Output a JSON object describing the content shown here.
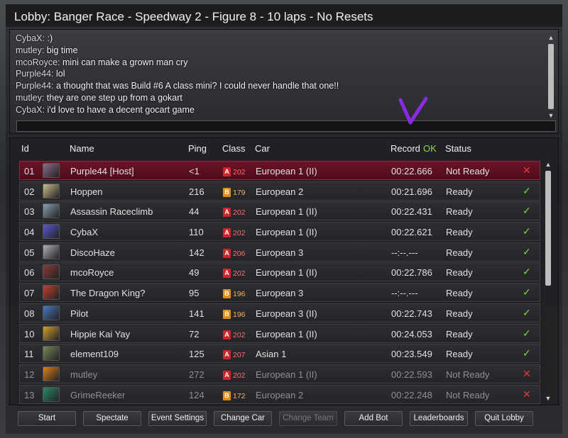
{
  "window": {
    "title": "Lobby: Banger Race - Speedway 2 - Figure 8 - 10 laps - No Resets"
  },
  "chat": {
    "lines": [
      {
        "user": "CybaX:",
        "text": " :)"
      },
      {
        "user": "mutley:",
        "text": " big time"
      },
      {
        "user": "mcoRoyce:",
        "text": " mini can make a grown man cry"
      },
      {
        "user": "Purple44:",
        "text": " lol"
      },
      {
        "user": "Purple44:",
        "text": " a thought that was Build #6 A class mini? I could never handle that one!!"
      },
      {
        "user": "mutley:",
        "text": " they are one step up from a gokart"
      },
      {
        "user": "CybaX:",
        "text": " i'd love to have a decent gocart game"
      }
    ],
    "input_value": ""
  },
  "table": {
    "headers": {
      "id": "Id",
      "name": "Name",
      "ping": "Ping",
      "class": "Class",
      "car": "Car",
      "record": "Record",
      "record_ok": "OK",
      "status": "Status"
    },
    "rows": [
      {
        "id": "01",
        "name": "Purple44 [Host]",
        "ping": "<1",
        "class_letter": "A",
        "class_num": "202",
        "car": "European 1 (II)",
        "record": "00:22.666",
        "status": "Not Ready",
        "ok": false,
        "host": true,
        "dim": false,
        "avatar_color": "#8a6e8a"
      },
      {
        "id": "02",
        "name": "Hoppen",
        "ping": "216",
        "class_letter": "B",
        "class_num": "179",
        "car": "European 2",
        "record": "00:21.696",
        "status": "Ready",
        "ok": true,
        "host": false,
        "dim": false,
        "avatar_color": "#c9c08a"
      },
      {
        "id": "03",
        "name": "Assassin Raceclimb",
        "ping": "44",
        "class_letter": "A",
        "class_num": "202",
        "car": "European 1 (II)",
        "record": "00:22.431",
        "status": "Ready",
        "ok": true,
        "host": false,
        "dim": false,
        "avatar_color": "#8aa0b0"
      },
      {
        "id": "04",
        "name": "CybaX",
        "ping": "110",
        "class_letter": "A",
        "class_num": "202",
        "car": "European 1 (II)",
        "record": "00:22.621",
        "status": "Ready",
        "ok": true,
        "host": false,
        "dim": false,
        "avatar_color": "#5a5ad0"
      },
      {
        "id": "05",
        "name": "DiscoHaze",
        "ping": "142",
        "class_letter": "A",
        "class_num": "206",
        "car": "European 3",
        "record": "--:--.---",
        "status": "Ready",
        "ok": true,
        "host": false,
        "dim": false,
        "avatar_color": "#b0b0b8"
      },
      {
        "id": "06",
        "name": "mcoRoyce",
        "ping": "49",
        "class_letter": "A",
        "class_num": "202",
        "car": "European 1 (II)",
        "record": "00:22.786",
        "status": "Ready",
        "ok": true,
        "host": false,
        "dim": false,
        "avatar_color": "#8a3a3a"
      },
      {
        "id": "07",
        "name": "The Dragon King?",
        "ping": "95",
        "class_letter": "B",
        "class_num": "196",
        "car": "European 3",
        "record": "--:--.---",
        "status": "Ready",
        "ok": true,
        "host": false,
        "dim": false,
        "avatar_color": "#c04030"
      },
      {
        "id": "08",
        "name": "Pilot",
        "ping": "141",
        "class_letter": "B",
        "class_num": "196",
        "car": "European 3 (II)",
        "record": "00:22.743",
        "status": "Ready",
        "ok": true,
        "host": false,
        "dim": false,
        "avatar_color": "#4a7ac0"
      },
      {
        "id": "10",
        "name": "Hippie Kai Yay",
        "ping": "72",
        "class_letter": "A",
        "class_num": "202",
        "car": "European 1 (II)",
        "record": "00:24.053",
        "status": "Ready",
        "ok": true,
        "host": false,
        "dim": false,
        "avatar_color": "#d0a030"
      },
      {
        "id": "11",
        "name": "element109",
        "ping": "125",
        "class_letter": "A",
        "class_num": "207",
        "car": "Asian 1",
        "record": "00:23.549",
        "status": "Ready",
        "ok": true,
        "host": false,
        "dim": false,
        "avatar_color": "#7a8a5a"
      },
      {
        "id": "12",
        "name": "mutley",
        "ping": "272",
        "class_letter": "A",
        "class_num": "202",
        "car": "European 1 (II)",
        "record": "00:22.593",
        "status": "Not Ready",
        "ok": false,
        "host": false,
        "dim": true,
        "avatar_color": "#e08020"
      },
      {
        "id": "13",
        "name": "GrimeReeker",
        "ping": "124",
        "class_letter": "B",
        "class_num": "172",
        "car": "European 2",
        "record": "00:22.248",
        "status": "Not Ready",
        "ok": false,
        "host": false,
        "dim": true,
        "avatar_color": "#2a8a6a"
      }
    ]
  },
  "buttons": [
    {
      "key": "start",
      "label": "Start",
      "disabled": false
    },
    {
      "key": "spectate",
      "label": "Spectate",
      "disabled": false
    },
    {
      "key": "event-settings",
      "label": "Event Settings",
      "disabled": false
    },
    {
      "key": "change-car",
      "label": "Change Car",
      "disabled": false
    },
    {
      "key": "change-team",
      "label": "Change Team",
      "disabled": true
    },
    {
      "key": "add-bot",
      "label": "Add Bot",
      "disabled": false
    },
    {
      "key": "leaderboards",
      "label": "Leaderboards",
      "disabled": false
    },
    {
      "key": "quit-lobby",
      "label": "Quit Lobby",
      "disabled": false
    }
  ],
  "icons": {
    "ready": "check-icon",
    "not_ready": "cross-icon"
  },
  "colors": {
    "host_row": "#6b1326",
    "ready_check": "#7ad83a",
    "not_ready_cross": "#e03a3a",
    "annotation": "#8a2be2"
  }
}
